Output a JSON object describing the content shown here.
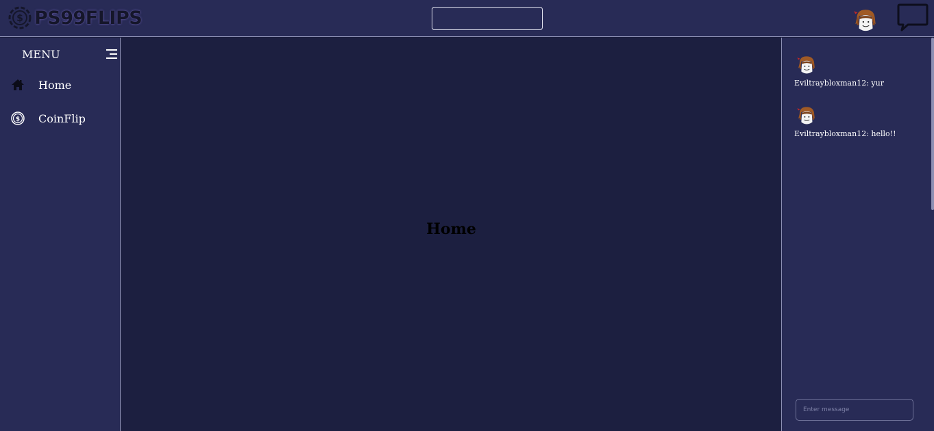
{
  "header": {
    "logo_text": "PS99FLIPS",
    "icons": {
      "logo": "coin-dollar-icon",
      "avatar": "user-avatar",
      "chat": "chat-bubble-icon"
    }
  },
  "sidebar": {
    "menu_label": "MENU",
    "items": [
      {
        "label": "Home",
        "icon": "home-icon"
      },
      {
        "label": "CoinFlip",
        "icon": "coin-dollar-icon"
      }
    ]
  },
  "main": {
    "title": "Home"
  },
  "chat": {
    "messages": [
      {
        "user": "Eviltraybloxman12",
        "text": "Eviltraybloxman12: yur"
      },
      {
        "user": "Eviltraybloxman12",
        "text": "Eviltraybloxman12: hello!!"
      }
    ],
    "input_placeholder": "Enter message"
  },
  "colors": {
    "topbar": "#282b56",
    "sidebar": "#282b56",
    "main_background": "#1c1f40",
    "border": "#8d90b4",
    "text": "#ffffff"
  }
}
